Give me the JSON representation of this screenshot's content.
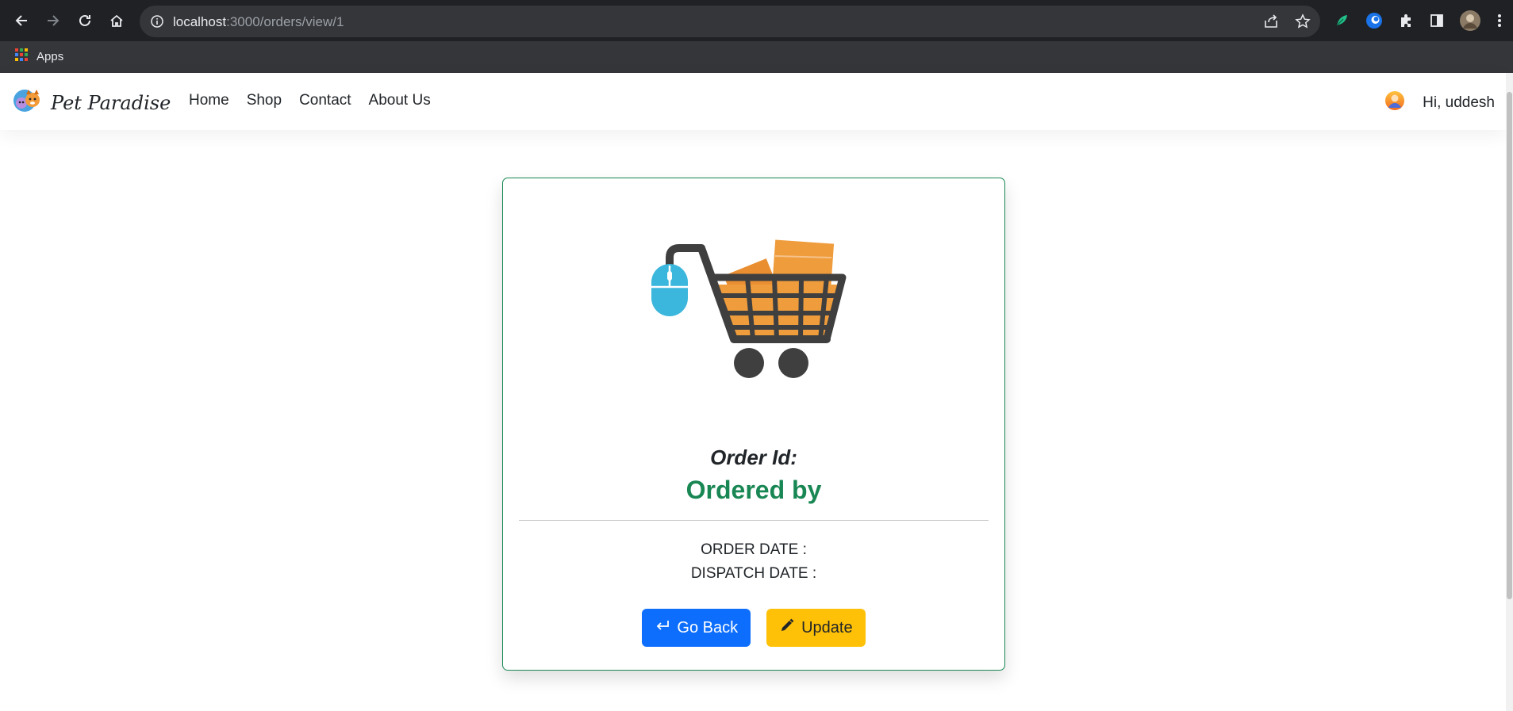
{
  "browser": {
    "url_host": "localhost",
    "url_path": ":3000/orders/view/1",
    "bookmarks": [
      {
        "label": "Apps",
        "icon": "apps-grid-icon"
      }
    ]
  },
  "navbar": {
    "brand": "Pet Paradise",
    "links": [
      {
        "label": "Home"
      },
      {
        "label": "Shop"
      },
      {
        "label": "Contact"
      },
      {
        "label": "About Us"
      }
    ],
    "greeting": "Hi, uddesh"
  },
  "order": {
    "id_label": "Order Id:",
    "ordered_by_label": "Ordered by",
    "order_date_label": "ORDER DATE :",
    "dispatch_date_label": "DISPATCH DATE :",
    "back_label": "Go Back",
    "update_label": "Update"
  },
  "colors": {
    "accent_green": "#198754",
    "primary_blue": "#0d6efd",
    "warning_yellow": "#ffc107",
    "cart_orange": "#ef9c3c",
    "mouse_blue": "#3bb6dc"
  }
}
